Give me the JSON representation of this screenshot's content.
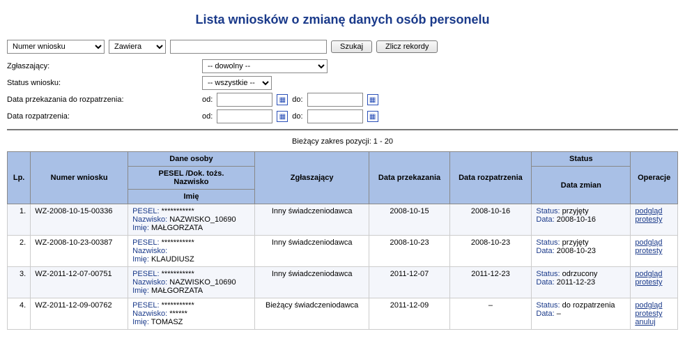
{
  "title": "Lista wniosków o zmianę danych osób personelu",
  "search": {
    "fieldOptions": [
      "Numer wniosku"
    ],
    "fieldSelected": "Numer wniosku",
    "opOptions": [
      "Zawiera"
    ],
    "opSelected": "Zawiera",
    "text": "",
    "btnSearch": "Szukaj",
    "btnCount": "Zlicz rekordy"
  },
  "filters": {
    "reporterLabel": "Zgłaszający:",
    "reporterSelected": "-- dowolny --",
    "statusLabel": "Status wniosku:",
    "statusSelected": "-- wszystkie --",
    "dateForwardLabel": "Data przekazania do rozpatrzenia:",
    "dateReviewLabel": "Data rozpatrzenia:",
    "od": "od:",
    "do": "do:"
  },
  "rangeInfo": "Bieżący zakres pozycji: 1 - 20",
  "headers": {
    "lp": "Lp.",
    "nr": "Numer wniosku",
    "personTop": "Dane osoby",
    "personMid": "PESEL /Dok. tożs.\nNazwisko",
    "personBot": "Imię",
    "reporter": "Zgłaszający",
    "dateFwd": "Data przekazania",
    "dateRev": "Data rozpatrzenia",
    "statusTop": "Status",
    "statusBot": "Data zmian",
    "ops": "Operacje"
  },
  "labels": {
    "pesel": "PESEL:",
    "surname": "Nazwisko:",
    "name": "Imię:",
    "status": "Status:",
    "date": "Data:"
  },
  "rows": [
    {
      "lp": "1.",
      "nr": "WZ-2008-10-15-00336",
      "pesel": "***********",
      "surname": "NAZWISKO_10690",
      "name": "MAŁGORZATA",
      "reporter": "Inny świadczeniodawca",
      "dateFwd": "2008-10-15",
      "dateRev": "2008-10-16",
      "status": "przyjęty",
      "statusDate": "2008-10-16",
      "ops": [
        "podgląd",
        "protesty"
      ]
    },
    {
      "lp": "2.",
      "nr": "WZ-2008-10-23-00387",
      "pesel": "***********",
      "surname": "  ",
      "name": "KLAUDIUSZ",
      "reporter": "Inny świadczeniodawca",
      "dateFwd": "2008-10-23",
      "dateRev": "2008-10-23",
      "status": "przyjęty",
      "statusDate": "2008-10-23",
      "ops": [
        "podgląd",
        "protesty"
      ]
    },
    {
      "lp": "3.",
      "nr": "WZ-2011-12-07-00751",
      "pesel": "***********",
      "surname": "NAZWISKO_10690",
      "name": "MAŁGORZATA",
      "reporter": "Inny świadczeniodawca",
      "dateFwd": "2011-12-07",
      "dateRev": "2011-12-23",
      "status": "odrzucony",
      "statusDate": "2011-12-23",
      "ops": [
        "podgląd",
        "protesty"
      ]
    },
    {
      "lp": "4.",
      "nr": "WZ-2011-12-09-00762",
      "pesel": "***********",
      "surname": "******",
      "name": "TOMASZ",
      "reporter": "Bieżący świadczeniodawca",
      "dateFwd": "2011-12-09",
      "dateRev": "–",
      "status": "do rozpatrzenia",
      "statusDate": "–",
      "ops": [
        "podgląd",
        "protesty",
        "anuluj"
      ]
    }
  ]
}
